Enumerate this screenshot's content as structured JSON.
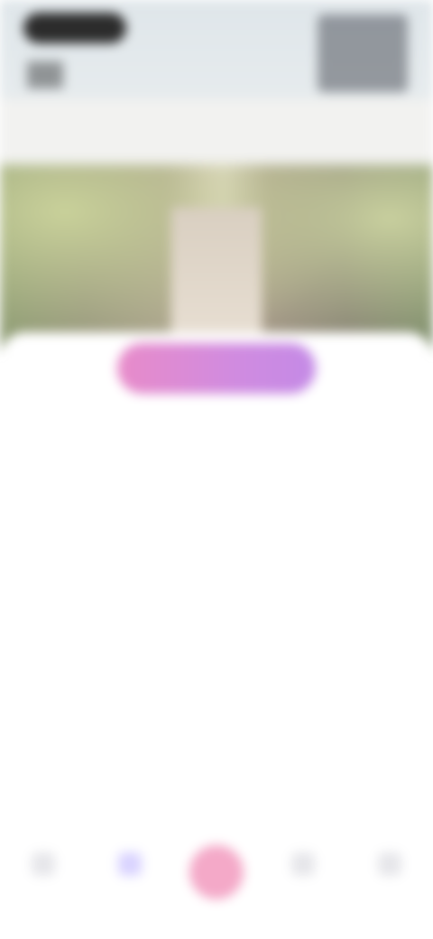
{
  "header": {
    "back_label": "",
    "right_label": ""
  },
  "hero": {
    "image_name": "campus-walkway-photo"
  },
  "cta": {
    "label": ""
  },
  "section": {
    "title": ""
  },
  "paragraphs": [
    "",
    ""
  ],
  "bottom_nav": {
    "items": [
      {
        "label": "",
        "icon": "home-icon"
      },
      {
        "label": "",
        "icon": "explore-icon"
      },
      {
        "label": "",
        "icon": "add-icon"
      },
      {
        "label": "",
        "icon": "message-icon"
      },
      {
        "label": "",
        "icon": "profile-icon"
      }
    ]
  },
  "colors": {
    "cta_start": "#e88bc9",
    "cta_end": "#c48ae6",
    "active_nav": "#d9d3ff",
    "center_button": "#f4a9c8"
  }
}
